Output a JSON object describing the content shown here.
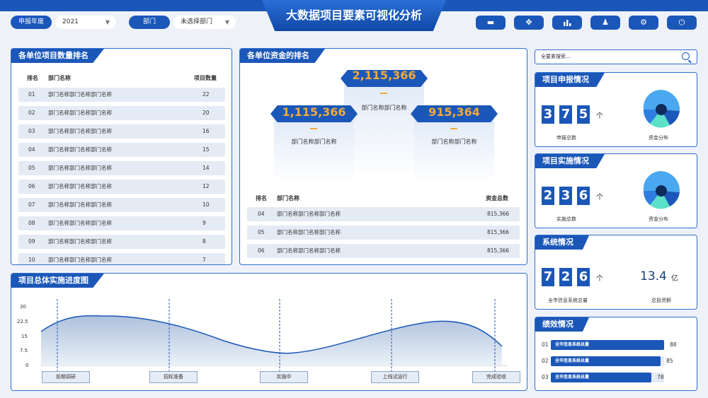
{
  "header": {
    "title": "大数据项目要素可视化分析",
    "year_label": "申报年度",
    "year_value": "2021",
    "dept_label": "部门",
    "dept_placeholder": "未选择部门",
    "toolbar_icons": [
      "monitor-icon",
      "grid-icon",
      "bar-chart-icon",
      "user-icon",
      "gear-icon",
      "power-icon"
    ]
  },
  "rank_panel": {
    "title": "各单位项目数量排名",
    "headers": [
      "排名",
      "部门名称",
      "项目数量"
    ],
    "rows": [
      {
        "rank": "01",
        "name": "部门名称部门名称部门名称",
        "count": "22"
      },
      {
        "rank": "02",
        "name": "部门名称部门名称部门名称",
        "count": "20"
      },
      {
        "rank": "03",
        "name": "部门名称部门名称部门名称",
        "count": "16"
      },
      {
        "rank": "04",
        "name": "部门名称部门名称部门名称",
        "count": "15"
      },
      {
        "rank": "05",
        "name": "部门名称部门名称部门名称",
        "count": "14"
      },
      {
        "rank": "06",
        "name": "部门名称部门名称部门名称",
        "count": "12"
      },
      {
        "rank": "07",
        "name": "部门名称部门名称部门名称",
        "count": "10"
      },
      {
        "rank": "08",
        "name": "部门名称部门名称部门名称",
        "count": "9"
      },
      {
        "rank": "09",
        "name": "部门名称部门名称部门名称",
        "count": "8"
      },
      {
        "rank": "10",
        "name": "部门名称部门名称部门名称",
        "count": "7"
      }
    ]
  },
  "fund_panel": {
    "title": "各单位资金的排名",
    "podium": [
      {
        "value": "2,115,366",
        "name": "部门名称部门名称"
      },
      {
        "value": "1,115,366",
        "name": "部门名称部门名称"
      },
      {
        "value": "915,364",
        "name": "部门名称部门名称"
      }
    ],
    "headers": [
      "排名",
      "部门名称",
      "资金总数"
    ],
    "rows": [
      {
        "rank": "04",
        "name": "部门名称部门名称部门名称",
        "amount": "815,366"
      },
      {
        "rank": "05",
        "name": "部门名称部门名称部门名称",
        "amount": "815,366"
      },
      {
        "rank": "06",
        "name": "部门名称部门名称部门名称",
        "amount": "815,366"
      }
    ]
  },
  "progress_panel": {
    "title": "项目总体实施进度图",
    "y_ticks": [
      "30",
      "22.5",
      "15",
      "7.5",
      "0"
    ],
    "stages": [
      "前期调研",
      "招标准备",
      "实施中",
      "上线试运行",
      "完成验收"
    ]
  },
  "search": {
    "placeholder": "全要素搜索..."
  },
  "apply_panel": {
    "title": "项目申报情况",
    "digits": [
      "3",
      "7",
      "5"
    ],
    "unit": "个",
    "label": "申报总数",
    "chart_label": "资金分布"
  },
  "impl_panel": {
    "title": "项目实施情况",
    "digits": [
      "2",
      "3",
      "6"
    ],
    "unit": "个",
    "label": "实施总数",
    "chart_label": "资金分布"
  },
  "system_panel": {
    "title": "系统情况",
    "digits": [
      "7",
      "2",
      "6"
    ],
    "unit": "个",
    "label": "全市信息系统总量",
    "invest_value": "13.4",
    "invest_unit": "亿",
    "invest_label": "总投资额"
  },
  "perf_panel": {
    "title": "绩效情况",
    "rows": [
      {
        "rank": "01",
        "label": "全市信息系统总量",
        "value": "88",
        "ratio": 0.88
      },
      {
        "rank": "02",
        "label": "全市信息系统总量",
        "value": "85",
        "ratio": 0.85
      },
      {
        "rank": "03",
        "label": "全市信息系统总量",
        "value": "78",
        "ratio": 0.78
      }
    ]
  },
  "colors": {
    "primary": "#1b57b8",
    "accent": "#f2a93b",
    "light_row": "#e4ebf5",
    "pie_light": "#4aa8f0",
    "pie_cyan": "#5de0c8"
  }
}
